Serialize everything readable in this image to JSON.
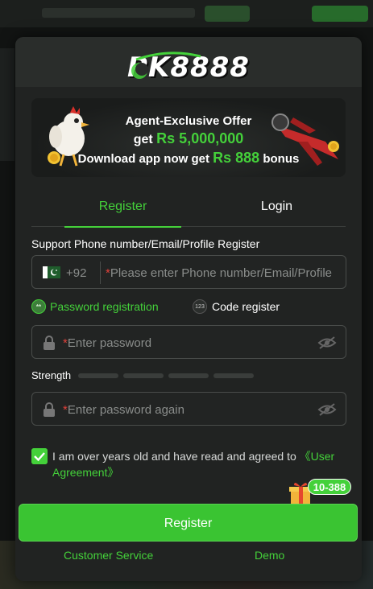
{
  "brand": {
    "logo_text": "PK8888"
  },
  "banner": {
    "line1": "Agent-Exclusive Offer",
    "line2_prefix": "get",
    "line2_amount": "Rs 5,000,000",
    "line3_prefix": "Download app now get",
    "line3_amount": "Rs 888",
    "line3_suffix": "bonus"
  },
  "tabs": [
    {
      "label": "Register",
      "active": true
    },
    {
      "label": "Login",
      "active": false
    }
  ],
  "form": {
    "phone_section_label": "Support Phone number/Email/Profile Register",
    "country_code": "+92",
    "required_mark": "*",
    "phone_placeholder": "Please enter Phone number/Email/Profile",
    "options": [
      {
        "label": "Password registration",
        "selected": true,
        "icon": "**"
      },
      {
        "label": "Code register",
        "selected": false,
        "icon": "123"
      }
    ],
    "password_placeholder": "Enter password",
    "strength_label": "Strength",
    "confirm_password_placeholder": "Enter password again",
    "agreement_text": "I am over years old and have read and agreed to",
    "agreement_link": "《User Agreement》",
    "agreement_checked": true
  },
  "actions": {
    "register_button": "Register",
    "gift_badge": "10-388"
  },
  "footer": {
    "customer_service": "Customer Service",
    "demo": "Demo"
  },
  "colors": {
    "accent": "#44d13a",
    "background": "#212322",
    "required": "#e0413b"
  },
  "icons": [
    "pakistan-flag-icon",
    "lock-icon",
    "eye-off-icon",
    "gift-icon",
    "checkbox-checked-icon"
  ]
}
